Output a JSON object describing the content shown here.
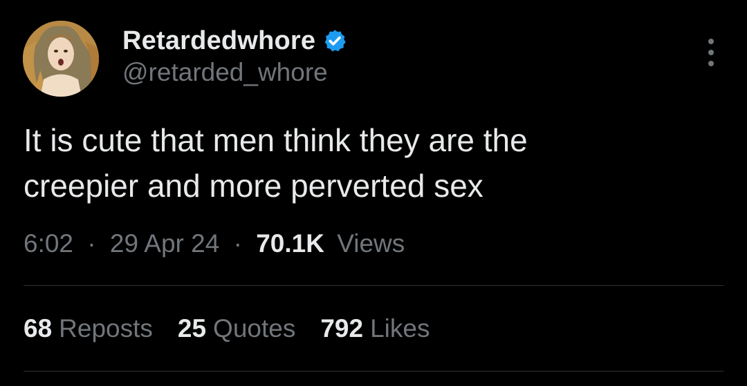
{
  "author": {
    "display_name": "Retardedwhore",
    "handle": "@retarded_whore",
    "verified": true,
    "verified_color": "#1d9bf0",
    "avatar_icon": "avatar-venus-painting"
  },
  "tweet": {
    "text_lines": [
      "It is cute that men think they are the",
      "creepier and more perverted sex"
    ],
    "time": "6:02",
    "date": "29 Apr 24",
    "separator": "·",
    "views_count": "70.1K",
    "views_label": "Views"
  },
  "stats": [
    {
      "count": "68",
      "label": "Reposts"
    },
    {
      "count": "25",
      "label": "Quotes"
    },
    {
      "count": "792",
      "label": "Likes"
    }
  ],
  "menu": {
    "icon": "more-vertical-icon"
  },
  "colors": {
    "background": "#000000",
    "primary_text": "#e7e9ea",
    "secondary_text": "#71767b",
    "divider": "#2f3336"
  }
}
